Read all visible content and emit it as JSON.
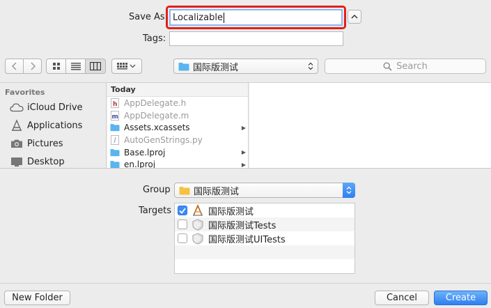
{
  "header": {
    "save_as_label": "Save As:",
    "save_as_value": "Localizable",
    "tags_label": "Tags:",
    "tags_value": ""
  },
  "toolbar": {
    "location": "国际版测试",
    "search_placeholder": "Search"
  },
  "sidebar": {
    "heading": "Favorites",
    "items": [
      {
        "label": "iCloud Drive",
        "icon": "cloud-icon"
      },
      {
        "label": "Applications",
        "icon": "applications-icon"
      },
      {
        "label": "Pictures",
        "icon": "camera-icon"
      },
      {
        "label": "Desktop",
        "icon": "desktop-icon"
      }
    ]
  },
  "browser": {
    "column_heading": "Today",
    "files": [
      {
        "name": "AppDelegate.h",
        "icon": "header-file-icon",
        "dimmed": true,
        "folder": false
      },
      {
        "name": "AppDelegate.m",
        "icon": "source-file-icon",
        "dimmed": true,
        "folder": false
      },
      {
        "name": "Assets.xcassets",
        "icon": "folder-icon",
        "dimmed": false,
        "folder": true
      },
      {
        "name": "AutoGenStrings.py",
        "icon": "script-file-icon",
        "dimmed": true,
        "folder": false
      },
      {
        "name": "Base.lproj",
        "icon": "folder-icon",
        "dimmed": false,
        "folder": true
      },
      {
        "name": "en.lproj",
        "icon": "folder-icon",
        "dimmed": false,
        "folder": true
      }
    ]
  },
  "options": {
    "group_label": "Group",
    "group_value": "国际版测试",
    "targets_label": "Targets",
    "targets": [
      {
        "name": "国际版测试",
        "checked": true,
        "icon": "app-target-icon"
      },
      {
        "name": "国际版测试Tests",
        "checked": false,
        "icon": "test-target-icon"
      },
      {
        "name": "国际版测试UITests",
        "checked": false,
        "icon": "test-target-icon"
      }
    ]
  },
  "footer": {
    "new_folder_label": "New Folder",
    "cancel_label": "Cancel",
    "create_label": "Create"
  },
  "colors": {
    "accent": "#3b8cf5",
    "highlight_border": "#e0201a",
    "folder": "#5ab4f0"
  }
}
